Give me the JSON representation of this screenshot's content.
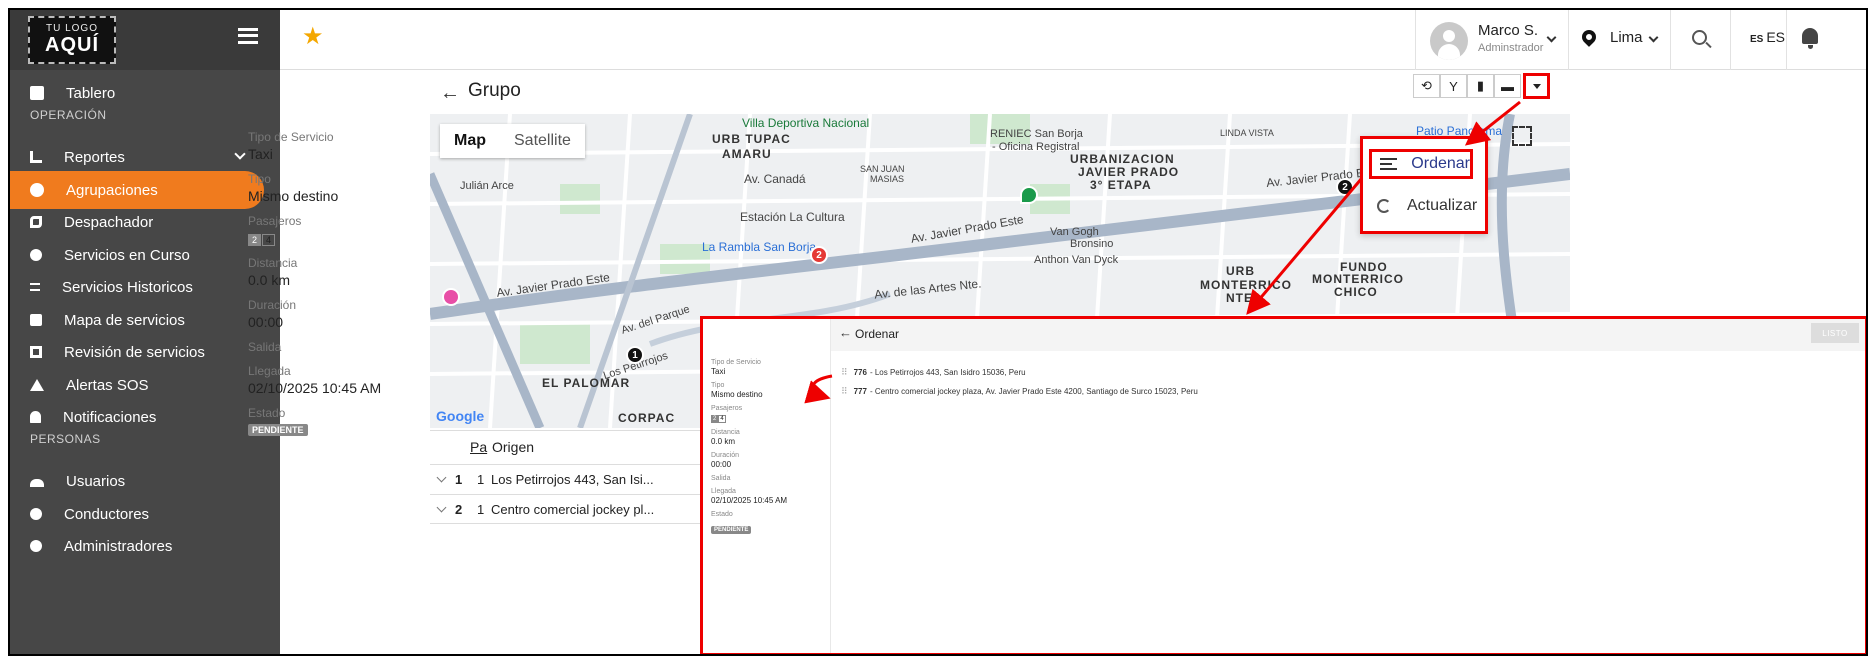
{
  "logo": {
    "line1": "TU LOGO",
    "line2": "AQUÍ"
  },
  "sidebar": {
    "items": [
      {
        "label": "Tablero",
        "icon": "dashboard-icon"
      },
      {
        "label": "Reportes",
        "icon": "bar-chart-icon"
      },
      {
        "label": "Agrupaciones",
        "icon": "group-icon"
      },
      {
        "label": "Despachador",
        "icon": "phone-icon"
      },
      {
        "label": "Servicios en Curso",
        "icon": "route-icon"
      },
      {
        "label": "Servicios Historicos",
        "icon": "list-icon"
      },
      {
        "label": "Mapa de servicios",
        "icon": "map-icon"
      },
      {
        "label": "Revisión de servicios",
        "icon": "review-icon"
      },
      {
        "label": "Alertas SOS",
        "icon": "warning-icon"
      },
      {
        "label": "Notificaciones",
        "icon": "bell-icon"
      },
      {
        "label": "Usuarios",
        "icon": "users-icon"
      },
      {
        "label": "Conductores",
        "icon": "driver-icon"
      },
      {
        "label": "Administradores",
        "icon": "admin-icon"
      }
    ],
    "sections": {
      "operacion": "OPERACIÓN",
      "personas": "PERSONAS"
    },
    "active": "Agrupaciones",
    "accent": "#f07b1e"
  },
  "topbar": {
    "user_name": "Marco S.",
    "user_role": "Adminstrador",
    "city": "Lima",
    "lang_flag": "ES",
    "lang": "ES"
  },
  "page": {
    "title": "Grupo"
  },
  "info": {
    "tipo_servicio_label": "Tipo de Servicio",
    "tipo_servicio": "Taxi",
    "tipo_label": "Tipo",
    "tipo": "Mismo destino",
    "pasajeros_label": "Pasajeros",
    "pasajeros_a": "2",
    "pasajeros_b": "4",
    "distancia_label": "Distancia",
    "distancia": "0.0 km",
    "duracion_label": "Duración",
    "duracion": "00:00",
    "salida_label": "Salida",
    "llegada_label": "Llegada",
    "llegada": "02/10/2025 10:45 AM",
    "estado_label": "Estado",
    "estado": "PENDIENTE"
  },
  "map": {
    "tab_map": "Map",
    "tab_satellite": "Satellite",
    "labels": [
      "Villa Deportiva Nacional",
      "URB TUPAC",
      "AMARU",
      "RENIEC San Borja",
      "- Oficina Registral",
      "LINDA VISTA",
      "Patio Panorama",
      "URBANIZACION",
      "JAVIER PRADO",
      "3° ETAPA",
      "Av. Canadá",
      "SAN JUAN",
      "MASIAS",
      "Julián Arce",
      "Estación La Cultura",
      "La Rambla San Borja",
      "Av. Javier Prado Este",
      "Av. Javier Prado Este",
      "Av. Javier Prado Este",
      "Van Gogh",
      "Bronsino",
      "Anthon Van Dyck",
      "Av. de las Artes Nte.",
      "URB",
      "MONTERRICO",
      "NTE",
      "FUNDO",
      "MONTERRICO",
      "CHICO",
      "EL PALOMAR",
      "CORPAC",
      "Av. del Parque",
      "Los Petirrojos",
      "Google"
    ],
    "marker_1": "1",
    "marker_2": "2"
  },
  "table": {
    "col_pa": "Pa",
    "col_origen": "Origen",
    "rows": [
      {
        "n": "1",
        "pa": "1",
        "origen": "Los Petirrojos 443, San Isi..."
      },
      {
        "n": "2",
        "pa": "1",
        "origen": "Centro comercial jockey pl..."
      }
    ]
  },
  "dropdown": {
    "ordenar": "Ordenar",
    "actualizar": "Actualizar"
  },
  "inset": {
    "title": "Ordenar",
    "done": "LISTO",
    "rows": [
      {
        "id": "776",
        "text": " - Los Petirrojos 443, San Isidro 15036, Peru"
      },
      {
        "id": "777",
        "text": " - Centro comercial jockey plaza, Av. Javier Prado Este 4200, Santiago de Surco 15023, Peru"
      }
    ]
  },
  "colors": {
    "highlight": "#ee0000",
    "star": "#f4a700"
  }
}
